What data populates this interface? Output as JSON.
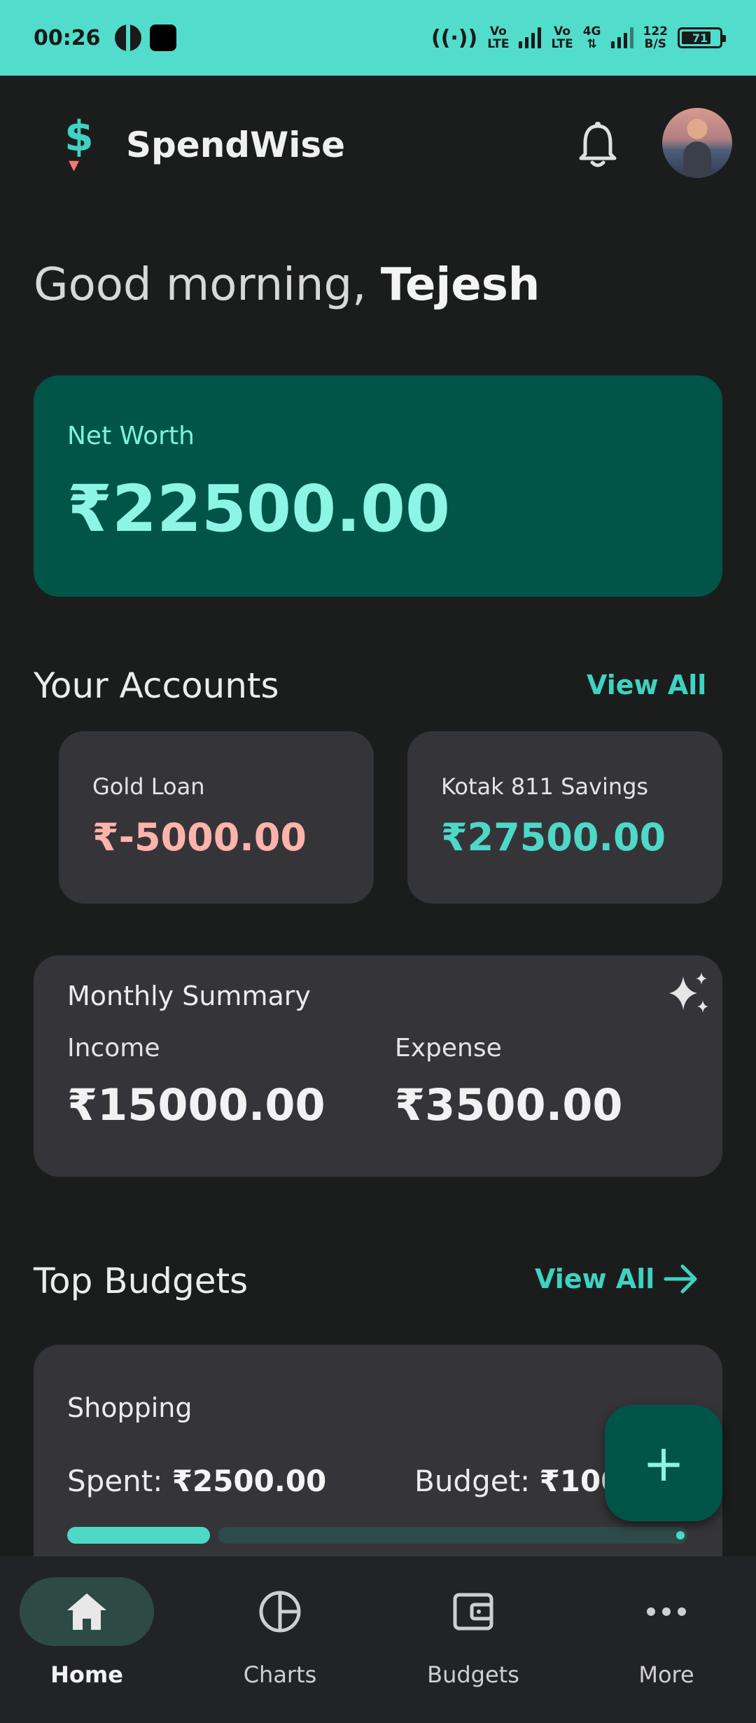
{
  "status_bar": {
    "time": "00:26",
    "volte1": "Vo\nLTE",
    "volte2": "Vo\nLTE",
    "net": "4G",
    "speed_top": "122",
    "speed_bottom": "B/S",
    "battery": "71",
    "battery_level": 0.71
  },
  "app": {
    "logo": "$",
    "title": "SpendWise"
  },
  "greeting": {
    "prefix": "Good morning, ",
    "name": "Tejesh"
  },
  "net_worth": {
    "label": "Net Worth",
    "value": "₹22500.00"
  },
  "accounts": {
    "title": "Your Accounts",
    "view_all": "View All",
    "items": [
      {
        "name": "Gold Loan",
        "value": "₹-5000.00",
        "color": "#ffb3aa"
      },
      {
        "name": "Kotak 811 Savings",
        "value": "₹27500.00",
        "color": "#4ed8c8"
      }
    ]
  },
  "monthly_summary": {
    "title": "Monthly Summary",
    "income_label": "Income",
    "income_value": "₹15000.00",
    "expense_label": "Expense",
    "expense_value": "₹3500.00"
  },
  "budgets": {
    "title": "Top Budgets",
    "view_all": "View All",
    "items": [
      {
        "name": "Shopping",
        "spent_label": "Spent: ",
        "spent": "₹2500.00",
        "budget_label": "Budget: ",
        "budget": "₹1000",
        "progress": 0.25
      }
    ]
  },
  "fab": {
    "label": "+"
  },
  "nav": {
    "items": [
      {
        "label": "Home",
        "active": true
      },
      {
        "label": "Charts"
      },
      {
        "label": "Budgets"
      },
      {
        "label": "More"
      }
    ]
  },
  "colors": {
    "accent": "#52dccb",
    "card": "#353539",
    "primary_dark": "#005548",
    "negative": "#ffb3aa"
  }
}
